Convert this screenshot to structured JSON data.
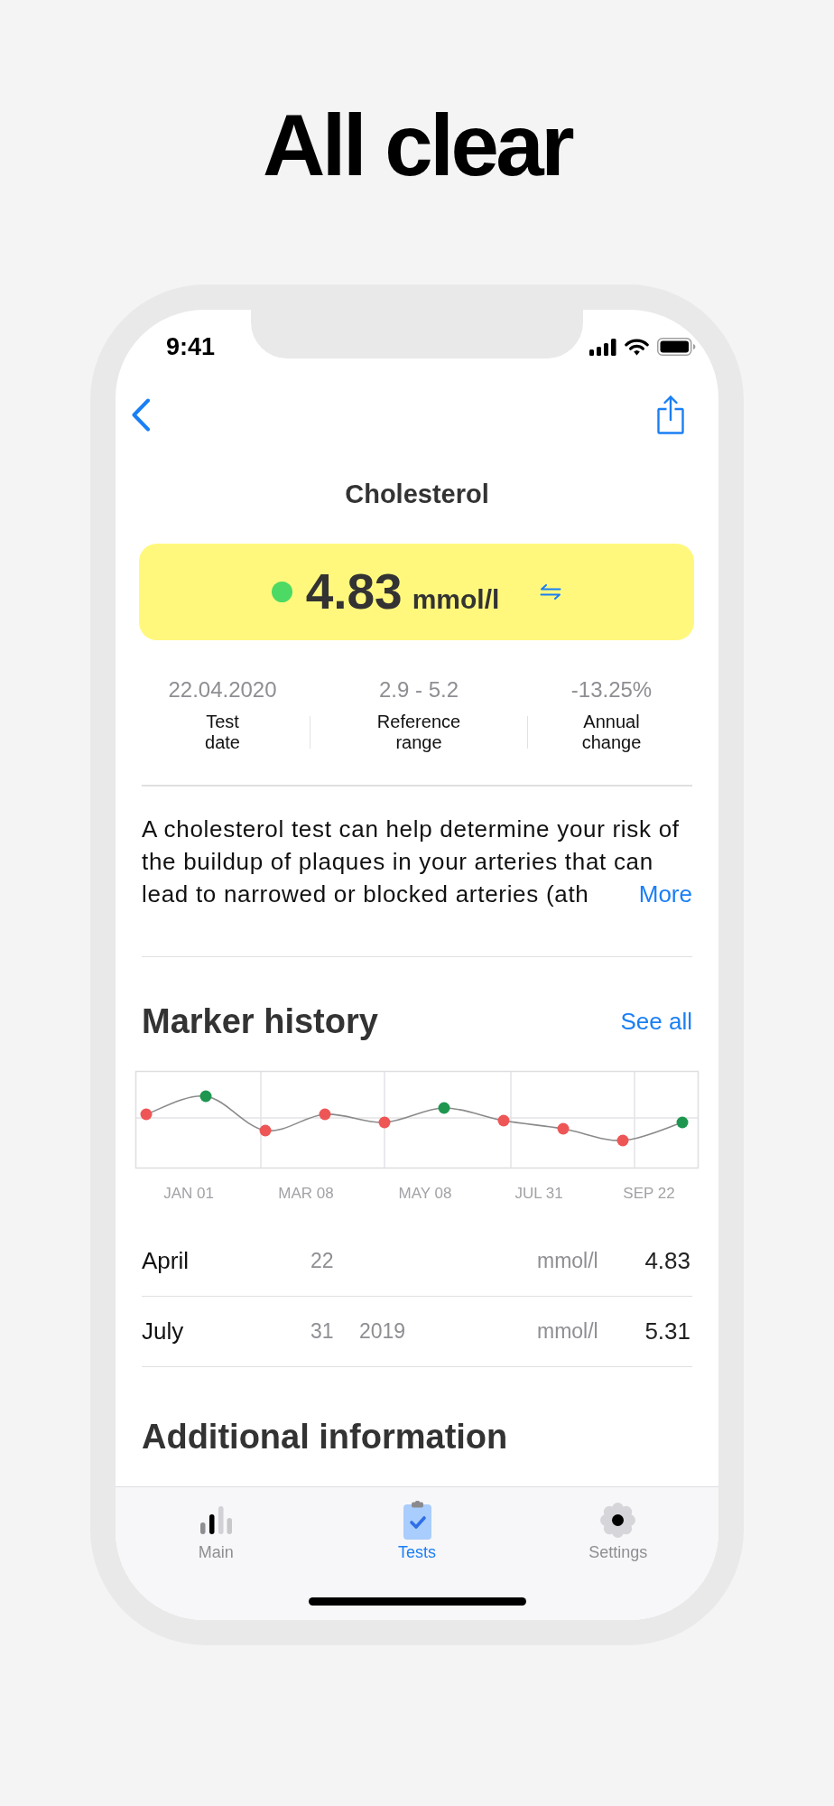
{
  "headline": "All clear",
  "status_bar": {
    "time": "9:41"
  },
  "screen": {
    "title": "Cholesterol"
  },
  "result": {
    "in_range": true,
    "value": "4.83",
    "unit": "mmol/l"
  },
  "stats": [
    {
      "value": "22.04.2020",
      "label": "Test date"
    },
    {
      "value": "2.9 - 5.2",
      "label": "Reference range"
    },
    {
      "value": "-13.25%",
      "label": "Annual change"
    }
  ],
  "description": {
    "text": "A cholesterol test can help determine your risk of the buildup of plaques in your arteries that can lead to narrowed or blocked arteries (ath",
    "link": "More"
  },
  "marker_history": {
    "title": "Marker history",
    "link": "See all",
    "chart": {
      "x_labels": [
        "JAN 01",
        "MAR 08",
        "MAY 08",
        "JUL 31",
        "SEP 22"
      ],
      "points": [
        {
          "color": "#ee5656"
        },
        {
          "color": "#1e9650"
        },
        {
          "color": "#ee5656"
        },
        {
          "color": "#ee5656"
        },
        {
          "color": "#ee5656"
        },
        {
          "color": "#1e9650"
        },
        {
          "color": "#ee5656"
        },
        {
          "color": "#ee5656"
        },
        {
          "color": "#ee5656"
        },
        {
          "color": "#1e9650"
        }
      ]
    },
    "rows": [
      {
        "month": "April",
        "day": "22",
        "unit": "mmol/l",
        "value": "4.83"
      },
      {
        "month": "July",
        "day": "31",
        "year": "2019",
        "unit": "mmol/l",
        "value": "5.31"
      }
    ]
  },
  "additional_information": {
    "title": "Additional information"
  },
  "tabs": [
    {
      "label": "Main",
      "kind": "bars",
      "selected": false
    },
    {
      "label": "Tests",
      "kind": "clipboard",
      "selected": true
    },
    {
      "label": "Settings",
      "kind": "gear",
      "selected": false
    }
  ]
}
